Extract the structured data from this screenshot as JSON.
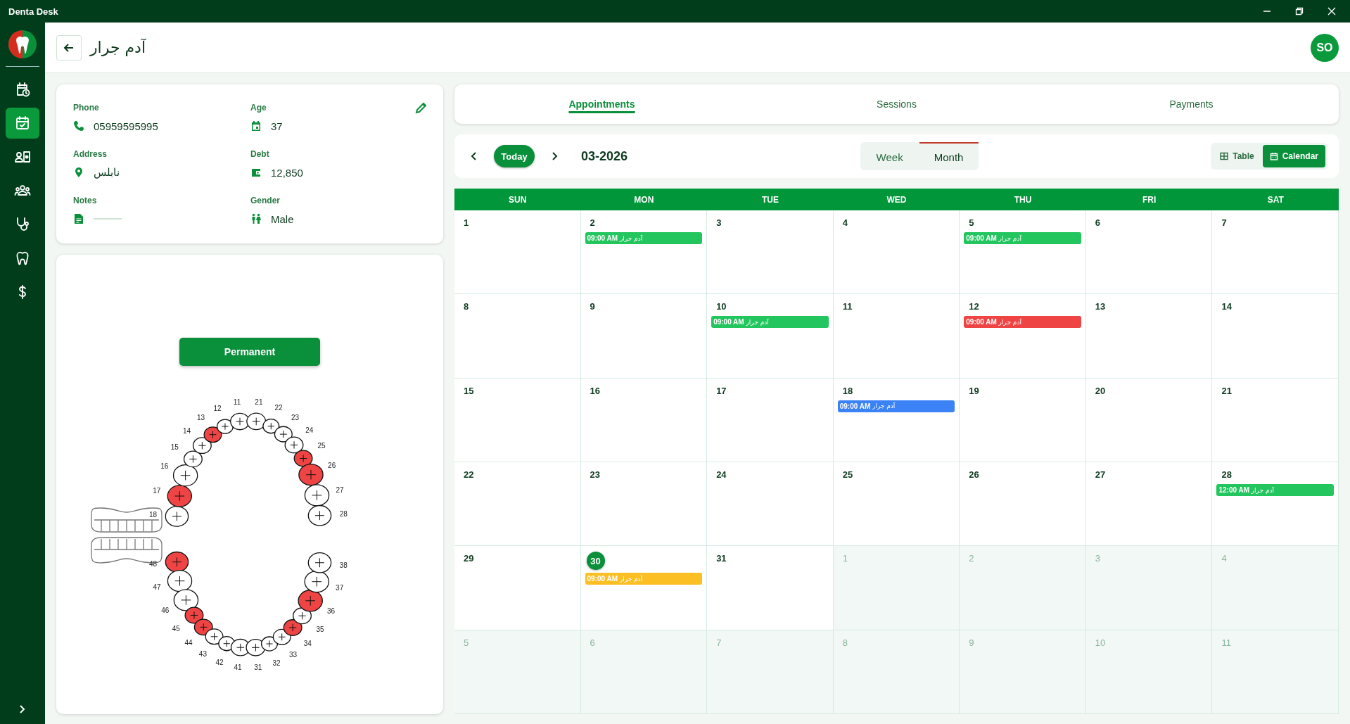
{
  "window": {
    "title": "Denta Desk"
  },
  "sidebar": {
    "items": [
      {
        "kind": "calendar-clock",
        "selected": false
      },
      {
        "kind": "calendar-check",
        "selected": true
      },
      {
        "kind": "id-card",
        "selected": false
      },
      {
        "kind": "people",
        "selected": false
      },
      {
        "kind": "stethoscope",
        "selected": false
      },
      {
        "kind": "tooth",
        "selected": false
      },
      {
        "kind": "dollar",
        "selected": false
      }
    ]
  },
  "header": {
    "patient_name": "آدم جرار",
    "avatar": "SO"
  },
  "info": {
    "fields": [
      {
        "label": "Phone",
        "value": "05959595995",
        "kind": "phone"
      },
      {
        "label": "Age",
        "value": "37",
        "kind": "calendar"
      },
      {
        "label": "Address",
        "value": "نابلس",
        "kind": "pin"
      },
      {
        "label": "Debt",
        "value": "12,850",
        "kind": "wallet"
      },
      {
        "label": "Notes",
        "kind": "note"
      },
      {
        "label": "Gender",
        "value": "Male",
        "kind": "gender"
      }
    ]
  },
  "teeth_chart": {
    "button": "Permanent",
    "upper_teeth": [
      {
        "number": "18",
        "decayed": false
      },
      {
        "number": "17",
        "decayed": true
      },
      {
        "number": "16",
        "decayed": false
      },
      {
        "number": "15",
        "decayed": false
      },
      {
        "number": "14",
        "decayed": false
      },
      {
        "number": "13",
        "decayed": true
      },
      {
        "number": "12",
        "decayed": false
      },
      {
        "number": "11",
        "decayed": false
      },
      {
        "number": "21",
        "decayed": false
      },
      {
        "number": "22",
        "decayed": false
      },
      {
        "number": "23",
        "decayed": false
      },
      {
        "number": "24",
        "decayed": false
      },
      {
        "number": "25",
        "decayed": true
      },
      {
        "number": "26",
        "decayed": true
      },
      {
        "number": "27",
        "decayed": false
      },
      {
        "number": "28",
        "decayed": false
      }
    ],
    "lower_teeth": [
      {
        "number": "48",
        "decayed": true
      },
      {
        "number": "47",
        "decayed": false
      },
      {
        "number": "46",
        "decayed": false
      },
      {
        "number": "45",
        "decayed": true
      },
      {
        "number": "44",
        "decayed": true
      },
      {
        "number": "43",
        "decayed": false
      },
      {
        "number": "42",
        "decayed": false
      },
      {
        "number": "41",
        "decayed": false
      },
      {
        "number": "31",
        "decayed": false
      },
      {
        "number": "32",
        "decayed": false
      },
      {
        "number": "33",
        "decayed": false
      },
      {
        "number": "34",
        "decayed": true
      },
      {
        "number": "35",
        "decayed": false
      },
      {
        "number": "36",
        "decayed": true
      },
      {
        "number": "37",
        "decayed": false
      },
      {
        "number": "38",
        "decayed": false
      }
    ]
  },
  "tabs": [
    {
      "label": "Appointments",
      "selected": true
    },
    {
      "label": "Sessions",
      "selected": false
    },
    {
      "label": "Payments",
      "selected": false
    }
  ],
  "toolbar": {
    "today": "Today",
    "period": "03-2026",
    "ranges": [
      {
        "label": "Week",
        "selected": false
      },
      {
        "label": "Month",
        "selected": true
      }
    ],
    "views": [
      {
        "label": "Table",
        "kind": "table",
        "selected": false
      },
      {
        "label": "Calendar",
        "kind": "calendar",
        "selected": true
      }
    ]
  },
  "calendar": {
    "weekdays": [
      "SUN",
      "MON",
      "TUE",
      "WED",
      "THU",
      "FRI",
      "SAT"
    ],
    "days": [
      {
        "day": "1",
        "outside": false,
        "today": false
      },
      {
        "day": "2",
        "outside": false,
        "today": false,
        "events": [
          {
            "time": "09:00 AM",
            "title": "آدم جرار",
            "color": "#22c55e"
          }
        ]
      },
      {
        "day": "3",
        "outside": false,
        "today": false
      },
      {
        "day": "4",
        "outside": false,
        "today": false
      },
      {
        "day": "5",
        "outside": false,
        "today": false,
        "events": [
          {
            "time": "09:00 AM",
            "title": "آدم جرار",
            "color": "#22c55e"
          }
        ]
      },
      {
        "day": "6",
        "outside": false,
        "today": false
      },
      {
        "day": "7",
        "outside": false,
        "today": false
      },
      {
        "day": "8",
        "outside": false,
        "today": false
      },
      {
        "day": "9",
        "outside": false,
        "today": false
      },
      {
        "day": "10",
        "outside": false,
        "today": false,
        "events": [
          {
            "time": "09:00 AM",
            "title": "آدم جرار",
            "color": "#22c55e"
          }
        ]
      },
      {
        "day": "11",
        "outside": false,
        "today": false
      },
      {
        "day": "12",
        "outside": false,
        "today": false,
        "events": [
          {
            "time": "09:00 AM",
            "title": "آدم جرار",
            "color": "#ef4444"
          }
        ]
      },
      {
        "day": "13",
        "outside": false,
        "today": false
      },
      {
        "day": "14",
        "outside": false,
        "today": false
      },
      {
        "day": "15",
        "outside": false,
        "today": false
      },
      {
        "day": "16",
        "outside": false,
        "today": false
      },
      {
        "day": "17",
        "outside": false,
        "today": false
      },
      {
        "day": "18",
        "outside": false,
        "today": false,
        "events": [
          {
            "time": "09:00 AM",
            "title": "آدم جرار",
            "color": "#3b82f6"
          }
        ]
      },
      {
        "day": "19",
        "outside": false,
        "today": false
      },
      {
        "day": "20",
        "outside": false,
        "today": false
      },
      {
        "day": "21",
        "outside": false,
        "today": false
      },
      {
        "day": "22",
        "outside": false,
        "today": false
      },
      {
        "day": "23",
        "outside": false,
        "today": false
      },
      {
        "day": "24",
        "outside": false,
        "today": false
      },
      {
        "day": "25",
        "outside": false,
        "today": false
      },
      {
        "day": "26",
        "outside": false,
        "today": false
      },
      {
        "day": "27",
        "outside": false,
        "today": false
      },
      {
        "day": "28",
        "outside": false,
        "today": false,
        "events": [
          {
            "time": "12:00 AM",
            "title": "آدم جرار",
            "color": "#22c55e"
          }
        ]
      },
      {
        "day": "29",
        "outside": false,
        "today": false
      },
      {
        "day": "30",
        "outside": false,
        "today": true,
        "events": [
          {
            "time": "09:00 AM",
            "title": "آدم جرار",
            "color": "#fbbf24"
          }
        ]
      },
      {
        "day": "31",
        "outside": false,
        "today": false
      },
      {
        "day": "1",
        "outside": true,
        "today": false
      },
      {
        "day": "2",
        "outside": true,
        "today": false
      },
      {
        "day": "3",
        "outside": true,
        "today": false
      },
      {
        "day": "4",
        "outside": true,
        "today": false
      },
      {
        "day": "5",
        "outside": true,
        "today": false
      },
      {
        "day": "6",
        "outside": true,
        "today": false
      },
      {
        "day": "7",
        "outside": true,
        "today": false
      },
      {
        "day": "8",
        "outside": true,
        "today": false
      },
      {
        "day": "9",
        "outside": true,
        "today": false
      },
      {
        "day": "10",
        "outside": true,
        "today": false
      },
      {
        "day": "11",
        "outside": true,
        "today": false
      }
    ]
  }
}
